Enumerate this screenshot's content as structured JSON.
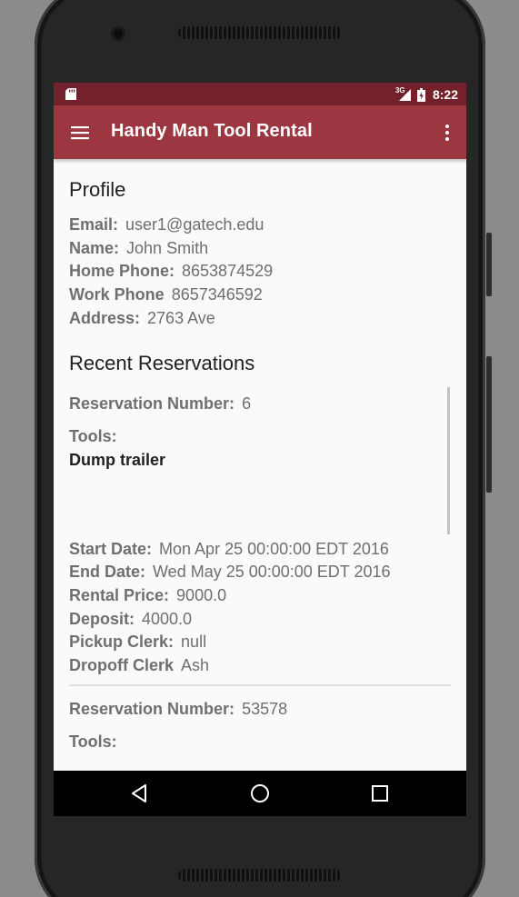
{
  "status_bar": {
    "network": "3G",
    "time": "8:22"
  },
  "app_bar": {
    "title": "Handy Man Tool Rental",
    "menu_icon": "hamburger-menu-icon",
    "overflow_icon": "more-vert-icon",
    "color": "#9c3640",
    "status_color": "#74212b"
  },
  "profile": {
    "heading": "Profile",
    "fields": [
      {
        "label": "Email:",
        "value": "user1@gatech.edu"
      },
      {
        "label": "Name:",
        "value": "John Smith"
      },
      {
        "label": "Home Phone:",
        "value": "8653874529"
      },
      {
        "label": "Work Phone",
        "value": "8657346592"
      },
      {
        "label": "Address:",
        "value": "2763 Ave"
      }
    ]
  },
  "reservations": {
    "heading": "Recent Reservations",
    "items": [
      {
        "number_label": "Reservation Number:",
        "number_value": "6",
        "tools_label": "Tools:",
        "tools": [
          "Dump trailer"
        ],
        "details": [
          {
            "label": "Start Date:",
            "value": "Mon Apr 25 00:00:00 EDT 2016"
          },
          {
            "label": "End Date:",
            "value": "Wed May 25 00:00:00 EDT 2016"
          },
          {
            "label": "Rental Price:",
            "value": "9000.0"
          },
          {
            "label": "Deposit:",
            "value": "4000.0"
          },
          {
            "label": "Pickup Clerk:",
            "value": "null"
          },
          {
            "label": "Dropoff Clerk",
            "value": "Ash"
          }
        ]
      },
      {
        "number_label": "Reservation Number:",
        "number_value": "53578",
        "tools_label": "Tools:"
      }
    ]
  },
  "nav_bar": {
    "back_icon": "back-triangle-icon",
    "home_icon": "home-circle-icon",
    "recents_icon": "recents-square-icon"
  }
}
